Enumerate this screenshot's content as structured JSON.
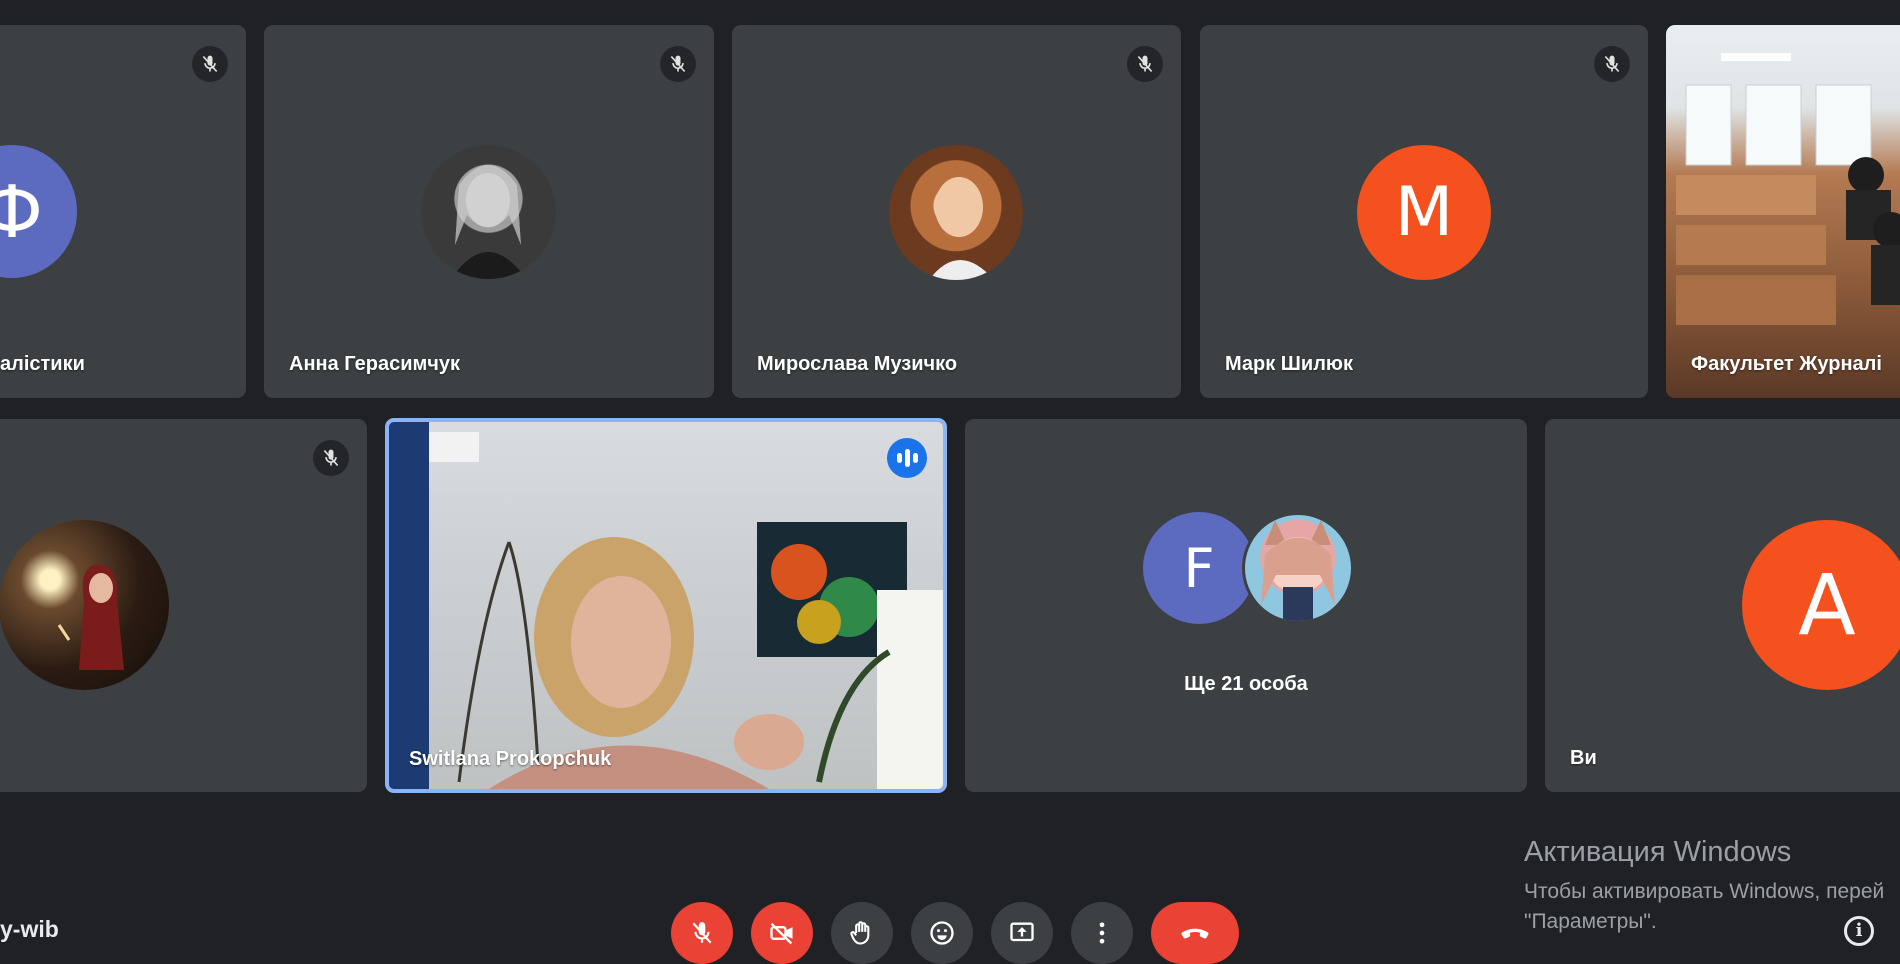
{
  "tiles": [
    {
      "name": "алістики",
      "avatar_letter": "Ф",
      "muted": true
    },
    {
      "name": "Анна Герасимчук",
      "muted": true
    },
    {
      "name": "Мирослава Музичко",
      "muted": true
    },
    {
      "name": "Марк Шилюк",
      "avatar_letter": "M",
      "muted": true
    },
    {
      "name": "Факультет Журналі",
      "muted": false
    },
    {
      "name": "",
      "muted": true
    },
    {
      "name": "Switlana Prokopchuk",
      "speaking": true
    },
    {
      "name": "Ще 21 особа",
      "avatar_letter": "F"
    },
    {
      "name": "Ви",
      "avatar_letter": "A"
    }
  ],
  "meeting_code": "y-wib",
  "watermark": {
    "title": "Активация Windows",
    "line1": "Чтобы активировать Windows, перей",
    "line2": "\"Параметры\"."
  },
  "colors": {
    "background": "#202124",
    "tile": "#3c4043",
    "avatar_blue": "#5c6bc0",
    "avatar_orange": "#f4511e",
    "danger": "#ea4335",
    "active_border": "#8ab4f8",
    "speaking": "#1a73e8"
  },
  "controls": [
    {
      "id": "mic",
      "icon": "mic-off-icon"
    },
    {
      "id": "camera",
      "icon": "camera-off-icon"
    },
    {
      "id": "raise-hand",
      "icon": "hand-icon"
    },
    {
      "id": "reactions",
      "icon": "emoji-icon"
    },
    {
      "id": "present",
      "icon": "present-screen-icon"
    },
    {
      "id": "more",
      "icon": "more-vert-icon"
    },
    {
      "id": "leave",
      "icon": "hang-up-icon"
    }
  ]
}
